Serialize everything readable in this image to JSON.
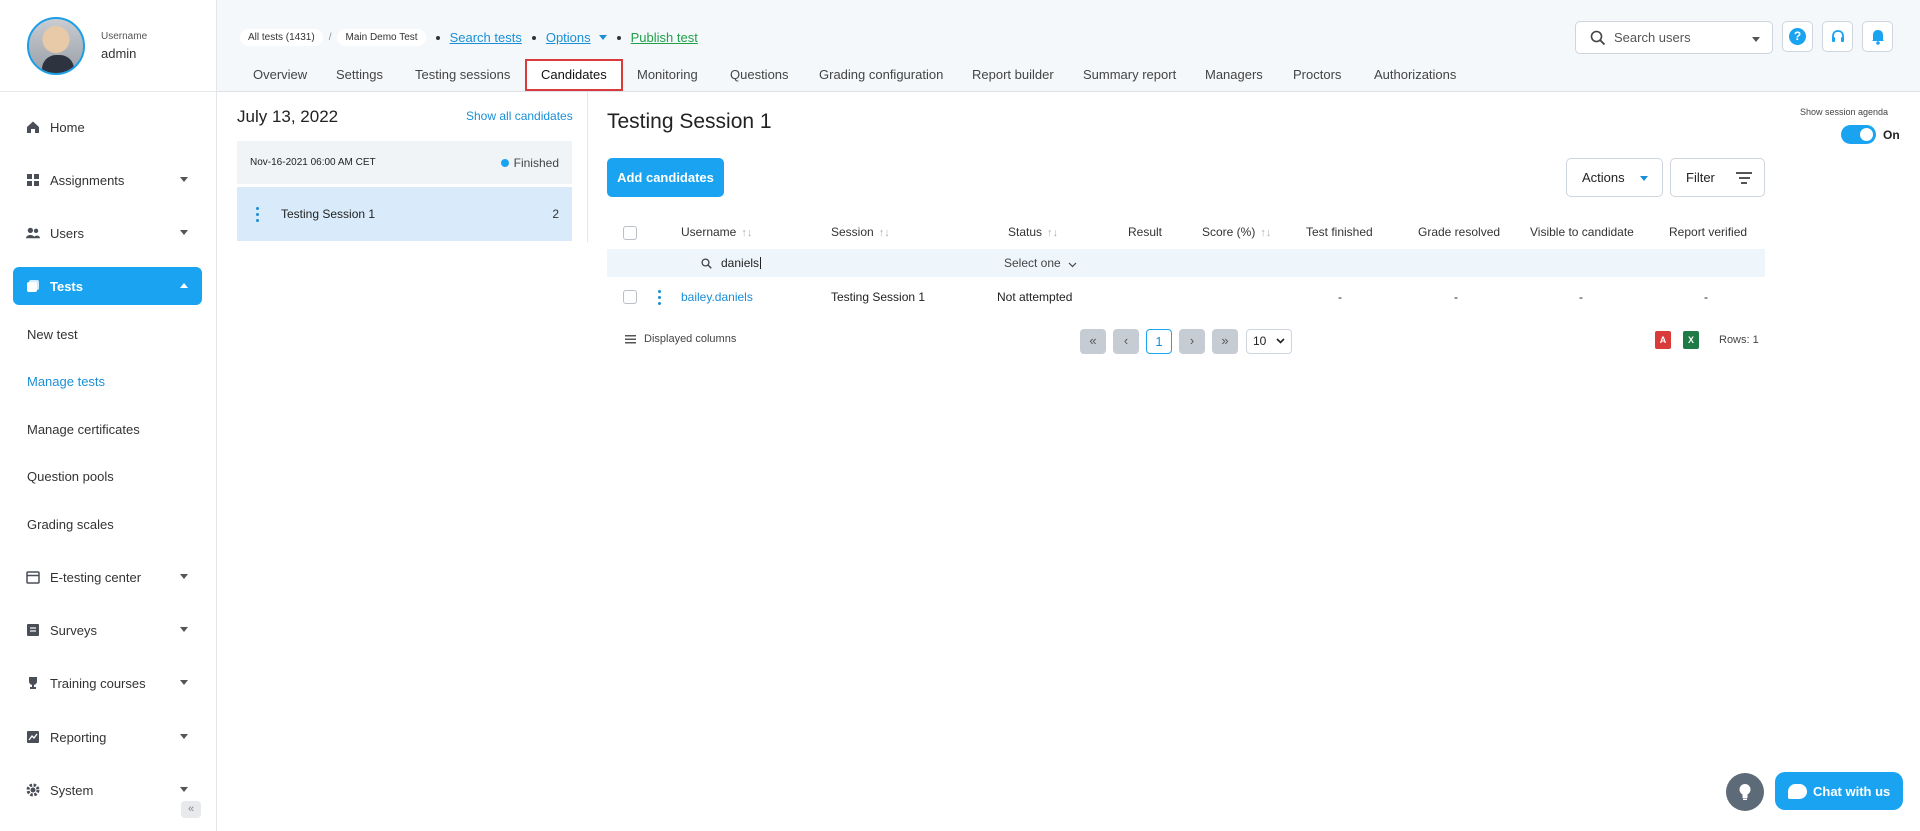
{
  "profile": {
    "label": "Username",
    "name": "admin"
  },
  "sidebar": {
    "items": [
      {
        "label": "Home",
        "icon": "home-icon"
      },
      {
        "label": "Assignments",
        "icon": "assignments-icon"
      },
      {
        "label": "Users",
        "icon": "users-icon"
      },
      {
        "label": "Tests",
        "icon": "tests-icon"
      },
      {
        "label": "E-testing center",
        "icon": "calendar-icon"
      },
      {
        "label": "Surveys",
        "icon": "survey-icon"
      },
      {
        "label": "Training courses",
        "icon": "trophy-icon"
      },
      {
        "label": "Reporting",
        "icon": "reporting-icon"
      },
      {
        "label": "System",
        "icon": "gear-icon"
      }
    ],
    "sub_items": [
      "New test",
      "Manage tests",
      "Manage certificates",
      "Question pools",
      "Grading scales"
    ]
  },
  "header": {
    "crumb_all": "All tests (1431)",
    "crumb_sep": "/",
    "crumb_test": "Main Demo Test",
    "search_tests": "Search tests",
    "options": "Options",
    "publish": "Publish test",
    "search_users_placeholder": "Search users",
    "help_glyph": "?"
  },
  "tabs": [
    "Overview",
    "Settings",
    "Testing sessions",
    "Candidates",
    "Monitoring",
    "Questions",
    "Grading configuration",
    "Report builder",
    "Summary report",
    "Managers",
    "Proctors",
    "Authorizations"
  ],
  "sessions": {
    "date_title": "July 13, 2022",
    "show_all": "Show all candidates",
    "date_row": "Nov-16-2021 06:00 AM CET",
    "status": "Finished",
    "session_name": "Testing Session 1",
    "session_count": "2"
  },
  "main": {
    "title": "Testing Session 1",
    "add_button": "Add candidates",
    "actions": "Actions",
    "filter": "Filter",
    "agenda_label": "Show session agenda",
    "agenda_state": "On"
  },
  "table": {
    "columns": [
      "Username",
      "Session",
      "Status",
      "Result",
      "Score (%)",
      "Test finished",
      "Grade resolved",
      "Visible to candidate",
      "Report verified"
    ],
    "filter_username": "daniels",
    "filter_status": "Select one",
    "row": {
      "username": "bailey.daniels",
      "session": "Testing Session 1",
      "status": "Not attempted",
      "result": "",
      "score": "",
      "test_finished": "-",
      "grade_resolved": "-",
      "visible": "-",
      "report_verified": "-"
    },
    "displayed_columns": "Displayed columns",
    "current_page": "1",
    "per_page": "10",
    "rows": "Rows: 1"
  },
  "chat": {
    "label": "Chat with us"
  },
  "colors": {
    "accent": "#1aa3f0",
    "active_tab_border": "#d93a3a",
    "link_green": "#1fa14a"
  }
}
